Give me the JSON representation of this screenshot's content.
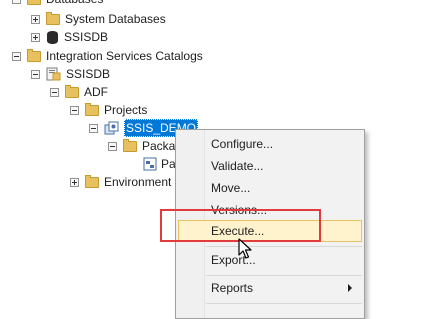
{
  "tree": {
    "databases": "Databases",
    "system_databases": "System Databases",
    "ssisdb_db": "SSISDB",
    "integration_services_catalogs": "Integration Services Catalogs",
    "ssisdb_catalog": "SSISDB",
    "adf": "ADF",
    "projects": "Projects",
    "ssis_demo": "SSIS_DEMO",
    "packages": "Packa",
    "package_item": "Pa",
    "environments": "Environment"
  },
  "context_menu": {
    "configure": "Configure...",
    "validate": "Validate...",
    "move": "Move...",
    "versions": "Versions...",
    "execute": "Execute...",
    "export": "Export...",
    "reports": "Reports",
    "hovered_item": "execute"
  },
  "colors": {
    "selection": "#0078d7",
    "highlight_border": "#e23b3b",
    "menu_hover": "#fff3cd",
    "folder": "#e7c15f"
  },
  "icons": {
    "folder": "folder-icon",
    "database": "database-icon",
    "catalog": "catalog-icon",
    "project": "project-icon",
    "package": "package-icon",
    "cursor": "mouse-cursor-icon",
    "submenu": "chevron-right-icon"
  }
}
